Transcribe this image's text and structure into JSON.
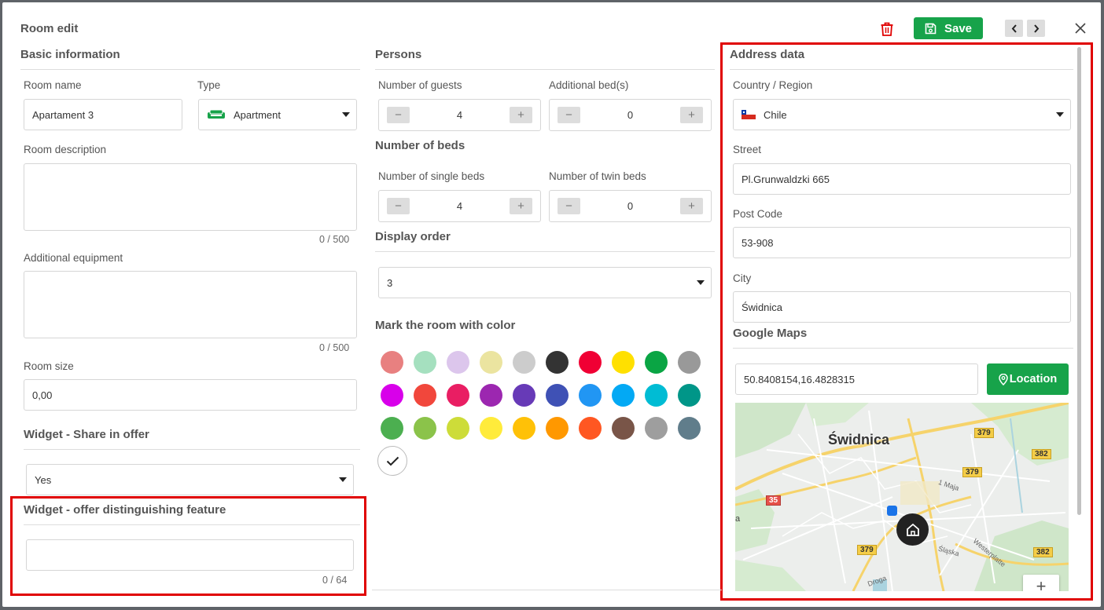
{
  "header": {
    "title": "Room edit",
    "save_label": "Save"
  },
  "basic": {
    "title": "Basic information",
    "room_name_label": "Room name",
    "room_name_value": "Apartament 3",
    "type_label": "Type",
    "type_value": "Apartment",
    "description_label": "Room description",
    "description_counter": "0 / 500",
    "equipment_label": "Additional equipment",
    "equipment_counter": "0 / 500",
    "size_label": "Room size",
    "size_value": "0,00",
    "widget_share_title": "Widget - Share in offer",
    "widget_share_value": "Yes",
    "widget_feature_title": "Widget - offer distinguishing feature",
    "widget_feature_counter": "0 / 64"
  },
  "persons": {
    "title": "Persons",
    "guests_label": "Number of guests",
    "guests_value": "4",
    "additional_beds_label": "Additional bed(s)",
    "additional_beds_value": "0",
    "beds_title": "Number of beds",
    "single_label": "Number of single beds",
    "single_value": "4",
    "twin_label": "Number of twin beds",
    "twin_value": "0",
    "order_title": "Display order",
    "order_value": "3",
    "color_title": "Mark the room with color",
    "colors": [
      "#e88080",
      "#a5e0bf",
      "#dcc6ec",
      "#ebe4a0",
      "#cccccc",
      "#333333",
      "#f00034",
      "#ffe000",
      "#0aa544",
      "#999999",
      "#d800ea",
      "#f1473c",
      "#e91e63",
      "#9c27b0",
      "#673ab7",
      "#3f51b5",
      "#2196f3",
      "#03a9f4",
      "#00bcd4",
      "#009688",
      "#4caf50",
      "#8bc34a",
      "#cddc39",
      "#ffeb3b",
      "#ffc107",
      "#ff9800",
      "#ff5722",
      "#795548",
      "#9e9e9e",
      "#607d8b"
    ]
  },
  "address": {
    "title": "Address data",
    "country_label": "Country / Region",
    "country_value": "Chile",
    "street_label": "Street",
    "street_value": "Pl.Grunwaldzki 665",
    "postcode_label": "Post Code",
    "postcode_value": "53-908",
    "city_label": "City",
    "city_value": "Świdnica",
    "maps_title": "Google Maps",
    "coords_value": "50.8408154,16.4828315",
    "location_label": "Location"
  },
  "map": {
    "city": "Świdnica",
    "roads": [
      "379",
      "382",
      "379",
      "35",
      "379",
      "382"
    ],
    "streets": [
      "1 Maja",
      "Śląska",
      "Westerplatte",
      "Droga"
    ],
    "edge_label": "a",
    "zoom_in": "+"
  }
}
